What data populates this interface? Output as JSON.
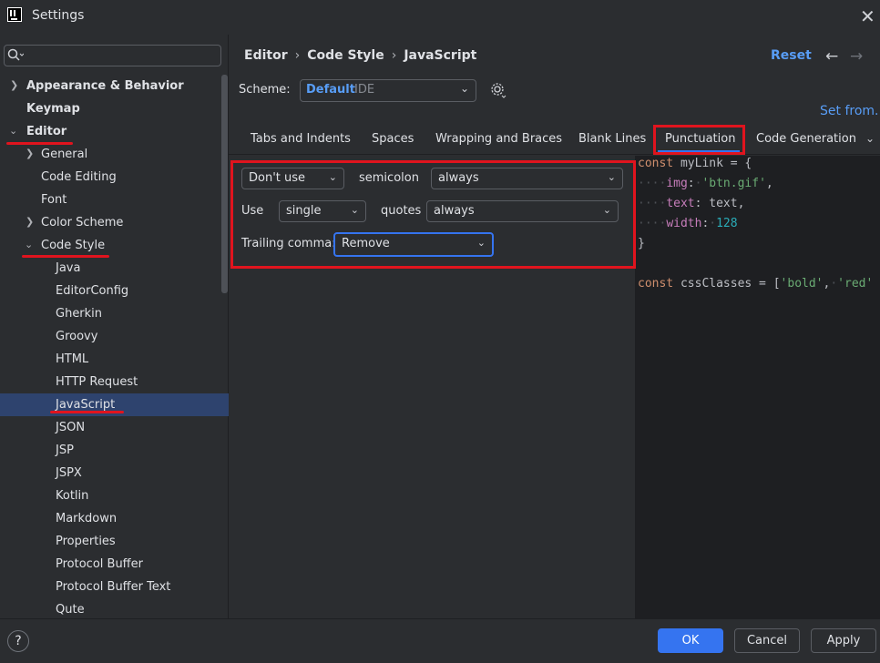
{
  "window": {
    "title": "Settings",
    "close_glyph": "✕"
  },
  "search": {
    "placeholder": ""
  },
  "sidebar": {
    "items": [
      {
        "label": "Appearance & Behavior"
      },
      {
        "label": "Keymap"
      },
      {
        "label": "Editor"
      },
      {
        "label": "General"
      },
      {
        "label": "Code Editing"
      },
      {
        "label": "Font"
      },
      {
        "label": "Color Scheme"
      },
      {
        "label": "Code Style"
      },
      {
        "label": "Java"
      },
      {
        "label": "EditorConfig"
      },
      {
        "label": "Gherkin"
      },
      {
        "label": "Groovy"
      },
      {
        "label": "HTML"
      },
      {
        "label": "HTTP Request"
      },
      {
        "label": "JavaScript"
      },
      {
        "label": "JSON"
      },
      {
        "label": "JSP"
      },
      {
        "label": "JSPX"
      },
      {
        "label": "Kotlin"
      },
      {
        "label": "Markdown"
      },
      {
        "label": "Properties"
      },
      {
        "label": "Protocol Buffer"
      },
      {
        "label": "Protocol Buffer Text"
      },
      {
        "label": "Qute"
      }
    ],
    "selected": "JavaScript"
  },
  "header": {
    "breadcrumb": [
      "Editor",
      "Code Style",
      "JavaScript"
    ],
    "breadcrumb_sep": "›",
    "reset": "Reset",
    "back": "←",
    "forward": "→"
  },
  "scheme": {
    "label": "Scheme:",
    "value": "Default",
    "scope": "IDE",
    "set_from": "Set from..."
  },
  "tabs": [
    {
      "label": "Tabs and Indents"
    },
    {
      "label": "Spaces"
    },
    {
      "label": "Wrapping and Braces"
    },
    {
      "label": "Blank Lines"
    },
    {
      "label": "Punctuation"
    },
    {
      "label": "Code Generation"
    }
  ],
  "active_tab": "Punctuation",
  "punctuation": {
    "semicolon_mode": "Don't use",
    "semicolon_label": "semicolon",
    "semicolon_when": "always",
    "quotes_prefix": "Use",
    "quotes_mode": "single",
    "quotes_label": "quotes",
    "quotes_when": "always",
    "trailing_label": "Trailing comma:",
    "trailing_value": "Remove"
  },
  "code": {
    "line1_kw": "const",
    "line1_rest": " myLink = {",
    "line2_prop": "img",
    "line2_str": "'btn.gif'",
    "line3_prop": "text",
    "line3_rest": " text,",
    "line4_prop": "width",
    "line4_num": "128",
    "line5": "}",
    "line7_kw": "const",
    "line7_rest": " cssClasses = [",
    "line7_str1": "'bold'",
    "line7_str2": "'red'"
  },
  "buttons": {
    "ok": "OK",
    "cancel": "Cancel",
    "apply": "Apply",
    "help": "?"
  },
  "colors": {
    "accent": "#3574f0",
    "link": "#589df6",
    "annotation": "#e0141e",
    "selection": "#2e436e"
  }
}
